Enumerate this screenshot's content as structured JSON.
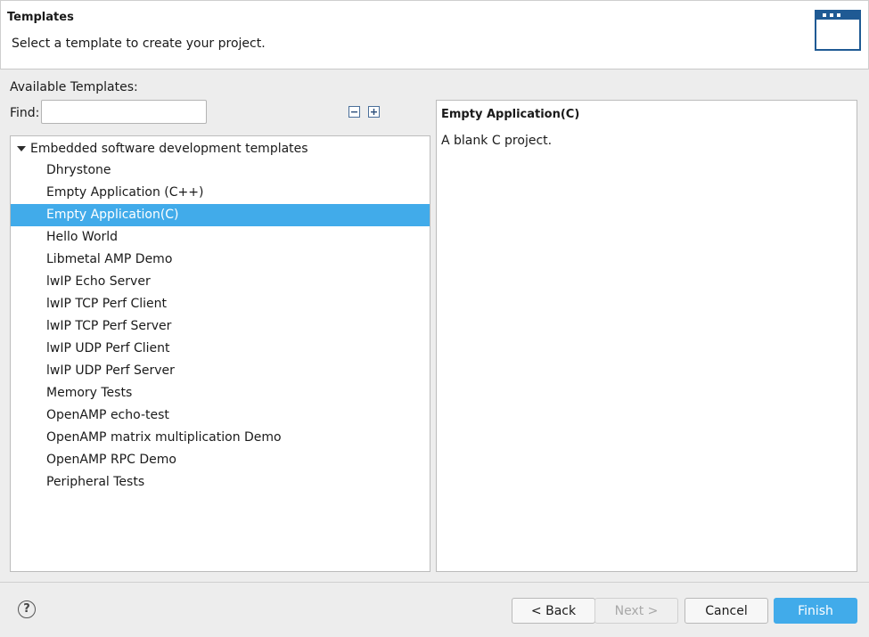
{
  "header": {
    "title": "Templates",
    "description": "Select a template to create your project.",
    "icon": "wizard-window-icon"
  },
  "templates": {
    "available_label": "Available Templates:",
    "find_label": "Find:",
    "find_value": "",
    "collapse_icon": "collapse-all-icon",
    "expand_icon": "expand-all-icon",
    "tree": {
      "root_label": "Embedded software development templates",
      "items": [
        {
          "label": "Dhrystone"
        },
        {
          "label": "Empty Application (C++)"
        },
        {
          "label": "Empty Application(C)",
          "selected": true
        },
        {
          "label": "Hello World"
        },
        {
          "label": "Libmetal AMP Demo"
        },
        {
          "label": "lwIP Echo Server"
        },
        {
          "label": "lwIP TCP Perf Client"
        },
        {
          "label": "lwIP TCP Perf Server"
        },
        {
          "label": "lwIP UDP Perf Client"
        },
        {
          "label": "lwIP UDP Perf Server"
        },
        {
          "label": "Memory Tests"
        },
        {
          "label": "OpenAMP echo-test"
        },
        {
          "label": "OpenAMP matrix multiplication Demo"
        },
        {
          "label": "OpenAMP RPC Demo"
        },
        {
          "label": "Peripheral Tests"
        }
      ]
    }
  },
  "description_panel": {
    "title": "Empty Application(C)",
    "text": "A blank C project."
  },
  "footer": {
    "help_icon": "help-icon",
    "back_label": "< Back",
    "next_label": "Next >",
    "cancel_label": "Cancel",
    "finish_label": "Finish"
  },
  "colors": {
    "selection": "#41abea",
    "accent": "#1f5a94"
  }
}
